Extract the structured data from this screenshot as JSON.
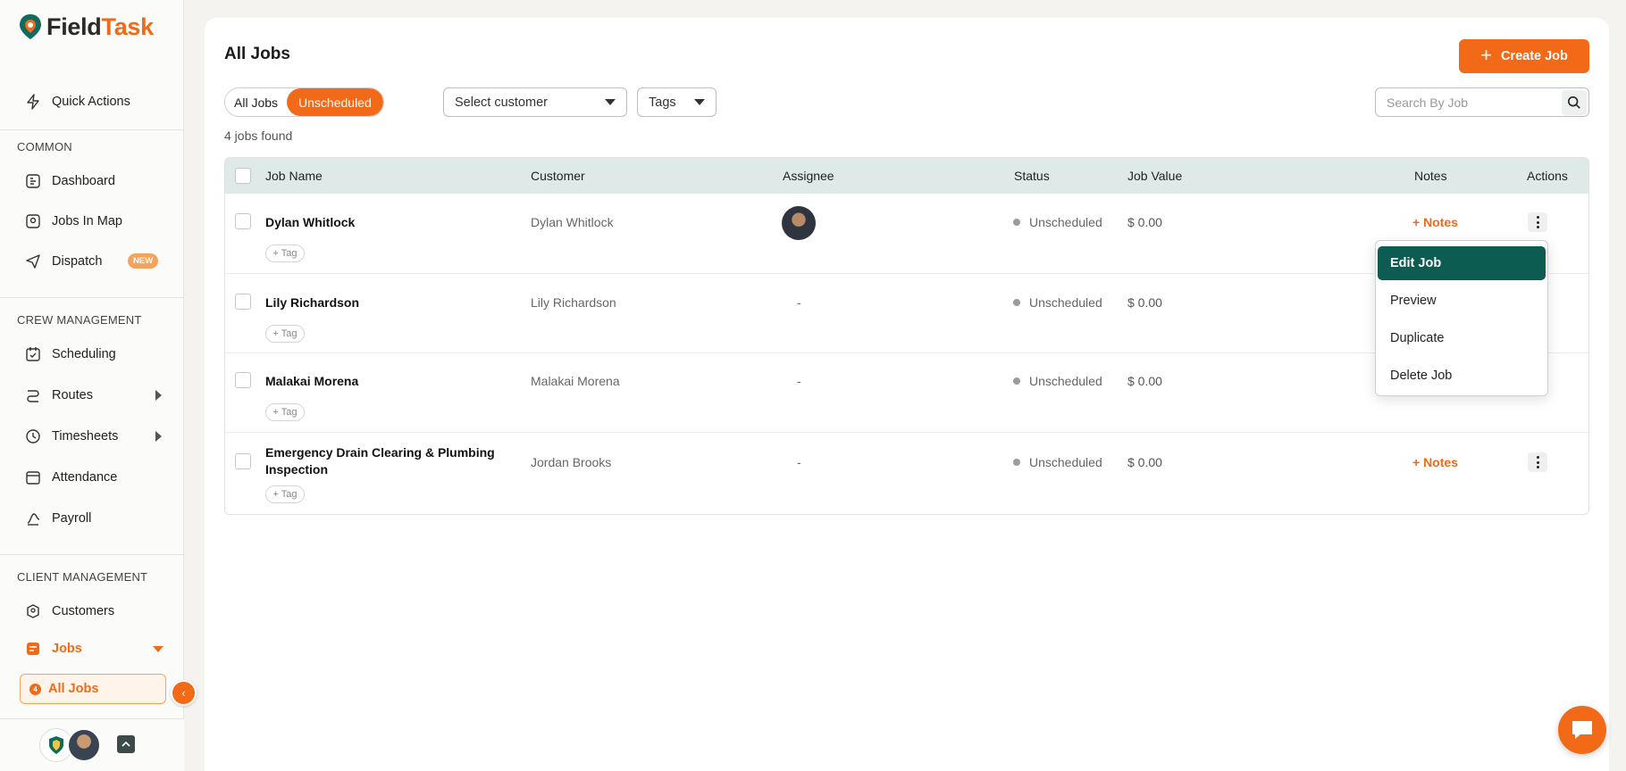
{
  "brand": {
    "name_part1": "Field",
    "name_part2": "Task",
    "accent": "#f26a17",
    "dark_accent": "#0c5c52"
  },
  "sidebar": {
    "quick_actions": "Quick Actions",
    "sections": {
      "common": "COMMON",
      "crew": "CREW MANAGEMENT",
      "client": "CLIENT MANAGEMENT"
    },
    "items": {
      "dashboard": "Dashboard",
      "jobs_in_map": "Jobs In Map",
      "dispatch": "Dispatch",
      "dispatch_badge": "NEW",
      "scheduling": "Scheduling",
      "routes": "Routes",
      "timesheets": "Timesheets",
      "attendance": "Attendance",
      "payroll": "Payroll",
      "customers": "Customers",
      "jobs": "Jobs",
      "all_jobs": "All Jobs"
    },
    "all_jobs_count": "4"
  },
  "main": {
    "title": "All Jobs",
    "create_button": "Create Job",
    "filters": {
      "all": "All Jobs",
      "unscheduled": "Unscheduled"
    },
    "customer_select": "Select customer",
    "tags_select": "Tags",
    "search_placeholder": "Search By Job",
    "count_text": "4 jobs found"
  },
  "table": {
    "headers": {
      "job_name": "Job Name",
      "customer": "Customer",
      "assignee": "Assignee",
      "status": "Status",
      "job_value": "Job Value",
      "notes": "Notes",
      "actions": "Actions"
    },
    "tag_label": "+ Tag",
    "notes_label": "+ Notes",
    "rows": [
      {
        "job_name": "Dylan Whitlock",
        "customer": "Dylan Whitlock",
        "assignee": "",
        "status": "Unscheduled",
        "value": "$ 0.00"
      },
      {
        "job_name": "Lily Richardson",
        "customer": "Lily Richardson",
        "assignee": "-",
        "status": "Unscheduled",
        "value": "$ 0.00"
      },
      {
        "job_name": "Malakai Morena",
        "customer": "Malakai Morena",
        "assignee": "-",
        "status": "Unscheduled",
        "value": "$ 0.00"
      },
      {
        "job_name": "Emergency Drain Clearing & Plumbing Inspection",
        "customer": "Jordan Brooks",
        "assignee": "-",
        "status": "Unscheduled",
        "value": "$ 0.00"
      }
    ]
  },
  "action_menu": {
    "items": [
      "Edit Job",
      "Preview",
      "Duplicate",
      "Delete Job"
    ]
  }
}
